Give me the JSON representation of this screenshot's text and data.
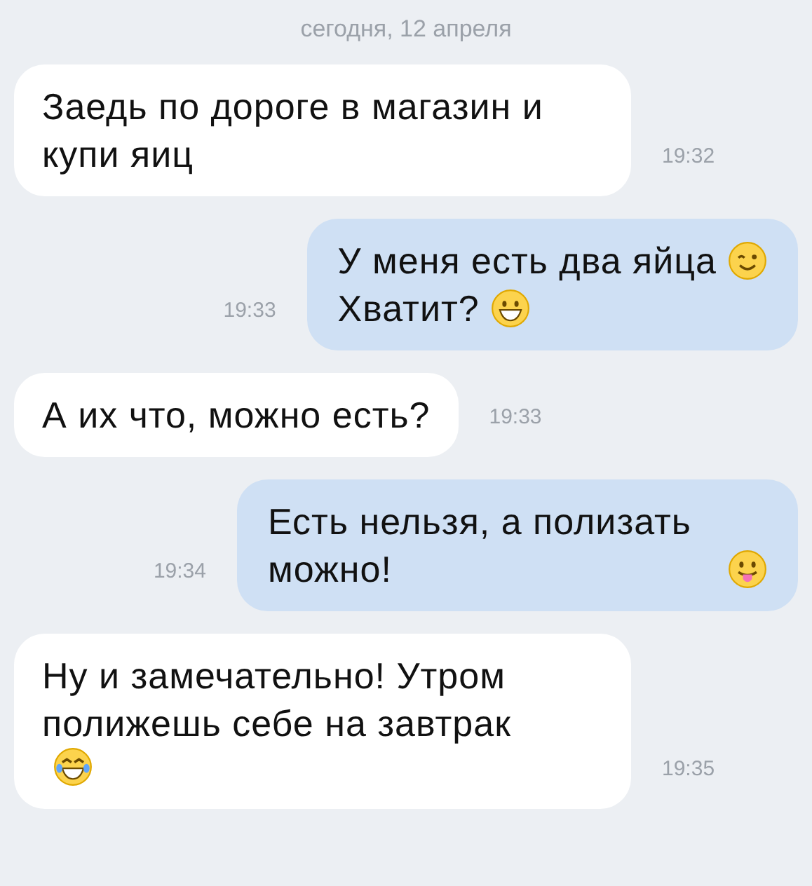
{
  "date_header": "сегодня, 12 апреля",
  "messages": [
    {
      "kind": "incoming",
      "time": "19:32",
      "body": [
        {
          "kind": "text",
          "text": "Заедь по дороге в магазин и купи яиц"
        }
      ]
    },
    {
      "kind": "outgoing",
      "time": "19:33",
      "body": [
        {
          "kind": "text",
          "text": "У меня есть два яйца"
        },
        {
          "kind": "wink"
        },
        {
          "kind": "break"
        },
        {
          "kind": "text",
          "text": "Хватит?"
        },
        {
          "kind": "grin"
        }
      ]
    },
    {
      "kind": "incoming",
      "time": "19:33",
      "body": [
        {
          "kind": "text",
          "text": "А их что, можно есть?"
        }
      ]
    },
    {
      "kind": "outgoing",
      "time": "19:34",
      "body": [
        {
          "kind": "text",
          "text": "Есть нельзя, а полизать можно!"
        },
        {
          "kind": "tongue"
        }
      ]
    },
    {
      "kind": "incoming",
      "time": "19:35",
      "body": [
        {
          "kind": "text",
          "text": "Ну и замечательно! Утром полижешь себе на завтрак"
        },
        {
          "kind": "break"
        },
        {
          "kind": "laugh"
        }
      ]
    }
  ]
}
